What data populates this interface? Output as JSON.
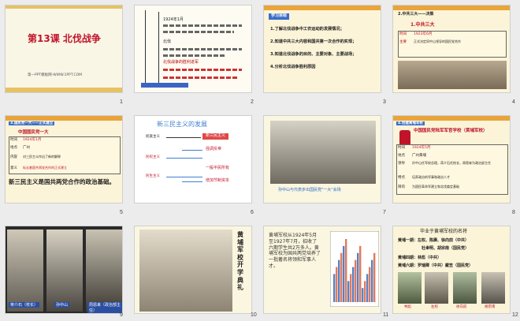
{
  "slides": [
    {
      "num": "1",
      "title": "第13课 北伐战争",
      "subtitle": "第一PPT模板网-WWW.1PPT.COM"
    },
    {
      "num": "2",
      "outline": [
        "1924年1月",
        "北伐",
        "北伐战争的胜利进军"
      ]
    },
    {
      "num": "3",
      "header": "学习目标",
      "items": [
        "1.了解北伐战争中工农运动的发展情况；",
        "2.知道中共三大内容和国共第一次合作的实现；",
        "3.知道北伐战争的目的、主要对象、主要战场；",
        "4.分析北伐战争胜利原因"
      ]
    },
    {
      "num": "4",
      "header": "2.中共三大——决策",
      "sub": "1.中共三大",
      "rows": [
        [
          "时间",
          "1923年6月"
        ],
        [
          "主要",
          "正式决定同中山领导的国民党合作"
        ]
      ]
    },
    {
      "num": "5",
      "header": "3.国民党一大——正式建立",
      "sub": "中国国民党一大",
      "rows": [
        [
          "时间",
          "1924年1月"
        ],
        [
          "地点",
          "广州"
        ],
        [
          "内容",
          "对三民主义作出了新的解释"
        ],
        [
          "意义",
          "标志着国共两党合作的正式建立"
        ]
      ],
      "note": "新三民主义是国共两党合作的政治基础。"
    },
    {
      "num": "6",
      "title": "新三民主义的发展",
      "left": [
        "民族主义",
        "民权主义",
        "民生主义"
      ],
      "right": [
        "新三民主义",
        "强调反帝",
        "一般平民所有",
        "增加节制资本"
      ]
    },
    {
      "num": "7",
      "caption": "孙中山与代表步出国民党\"一大\"会场"
    },
    {
      "num": "8",
      "header": "4.创建黄埔军校",
      "title": "中国国民党陆军军官学校（黄埔军校）",
      "rows": [
        [
          "时间",
          "1924年5月"
        ],
        [
          "地点",
          "广州黄埔"
        ],
        [
          "领导",
          "孙中山任军校总理，蒋介石任校长，周恩来为政治部主任"
        ],
        [
          "特点",
          "培养政治的军事和政治人才"
        ],
        [
          "目的",
          "为国民革命军建立和北伐奠定基础"
        ]
      ]
    },
    {
      "num": "9",
      "people": [
        "蒋介石（校长）",
        "孙中山",
        "周恩来（政治部主任）"
      ]
    },
    {
      "num": "10",
      "vertical": "黄埔军校开学典礼"
    },
    {
      "num": "11",
      "text": "黄埔军校从1924年5月至1927年7月，招收了六期学生共2万多人。黄埔军校为国共两党培养了一批著名将领和军事人才。",
      "chart_data": {
        "type": "bar",
        "values": [
          4,
          5,
          6,
          7,
          8,
          9,
          3,
          4,
          5,
          6,
          7,
          8,
          2,
          3,
          4,
          5,
          6,
          7
        ]
      }
    },
    {
      "num": "12",
      "title": "毕业于黄埔军校的名将",
      "lines": [
        "黄埔一期：左权、陈赓、徐向前（中共）",
        "杜聿明、胡宗南（国民党）",
        "黄埔四期：林彪（中共）",
        "黄埔六期：罗瑞卿（中共）戴笠（国民党）"
      ],
      "names": [
        "林彪",
        "左权",
        "徐向前",
        "胡宗南"
      ]
    }
  ]
}
